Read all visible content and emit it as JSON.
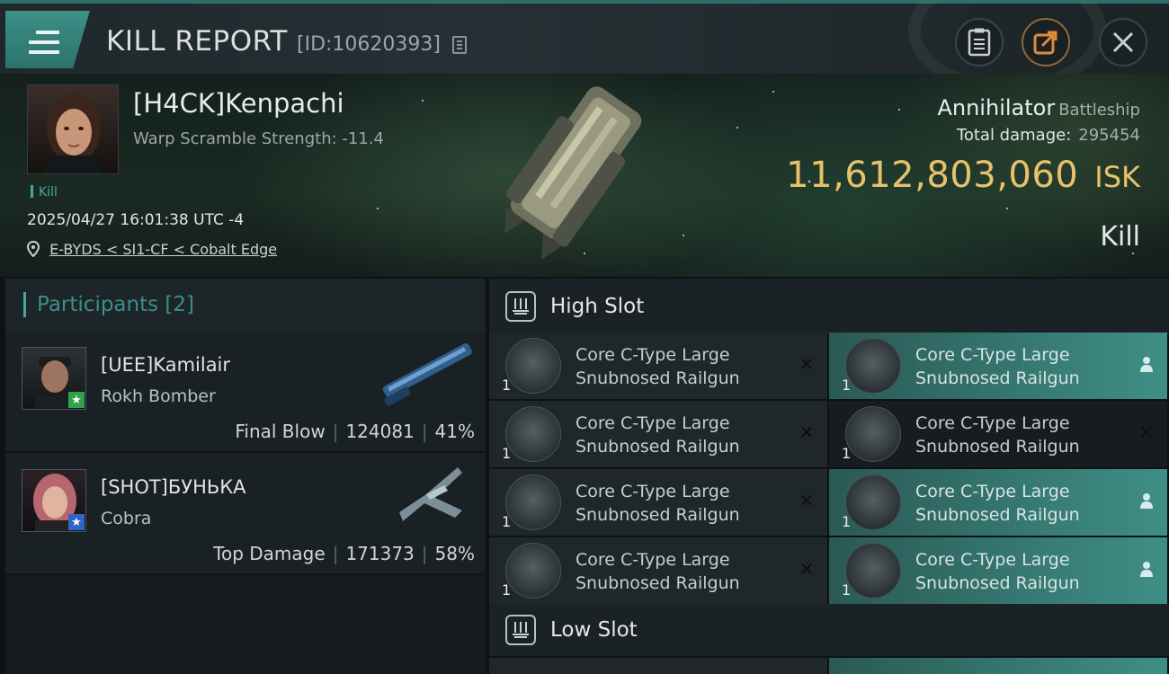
{
  "header": {
    "title": "KILL REPORT",
    "report_id": "[ID:10620393]"
  },
  "victim": {
    "name": "[H4CK]Kenpachi",
    "warp_scramble": "Warp Scramble Strength: -11.4",
    "kill_tag": "Kill",
    "timestamp": "2025/04/27 16:01:38 UTC -4",
    "location": "E-BYDS < SI1-CF < Cobalt Edge",
    "ship_name": "Annihilator",
    "ship_class": "Battleship",
    "total_damage_label": "Total damage:",
    "total_damage_value": "295454",
    "isk_value": "11,612,803,060",
    "isk_unit": "ISK",
    "result": "Kill"
  },
  "participants": {
    "header_label": "Participants",
    "count": "[2]",
    "items": [
      {
        "name": "[UEE]Kamilair",
        "ship": "Rokh Bomber",
        "role": "Final Blow",
        "damage": "124081",
        "percent": "41%",
        "badge_color": "#2fa34a"
      },
      {
        "name": "[SHOT]БУНЬКА",
        "ship": "Cobra",
        "role": "Top Damage",
        "damage": "171373",
        "percent": "58%",
        "badge_color": "#2f64c9"
      }
    ]
  },
  "high_slot": {
    "label": "High Slot",
    "modules": [
      {
        "qty": "1",
        "name": "Core C-Type Large Snubnosed Railgun",
        "status": "destroyed-icon"
      },
      {
        "qty": "1",
        "name": "Core C-Type Large Snubnosed Railgun",
        "status": "dropped-icon"
      },
      {
        "qty": "1",
        "name": "Core C-Type Large Snubnosed Railgun",
        "status": "destroyed-icon"
      },
      {
        "qty": "1",
        "name": "Core C-Type Large Snubnosed Railgun",
        "status": "destroyed-icon"
      },
      {
        "qty": "1",
        "name": "Core C-Type Large Snubnosed Railgun",
        "status": "destroyed-icon"
      },
      {
        "qty": "1",
        "name": "Core C-Type Large Snubnosed Railgun",
        "status": "dropped-icon"
      },
      {
        "qty": "1",
        "name": "Core C-Type Large Snubnosed Railgun",
        "status": "destroyed-icon"
      },
      {
        "qty": "1",
        "name": "Core C-Type Large Snubnosed Railgun",
        "status": "dropped-icon"
      }
    ]
  },
  "low_slot": {
    "label": "Low Slot"
  },
  "colors": {
    "accent_teal": "#4aa7a0",
    "isk_gold": "#e8c26a",
    "fitted_slot": "#3f8f87"
  }
}
